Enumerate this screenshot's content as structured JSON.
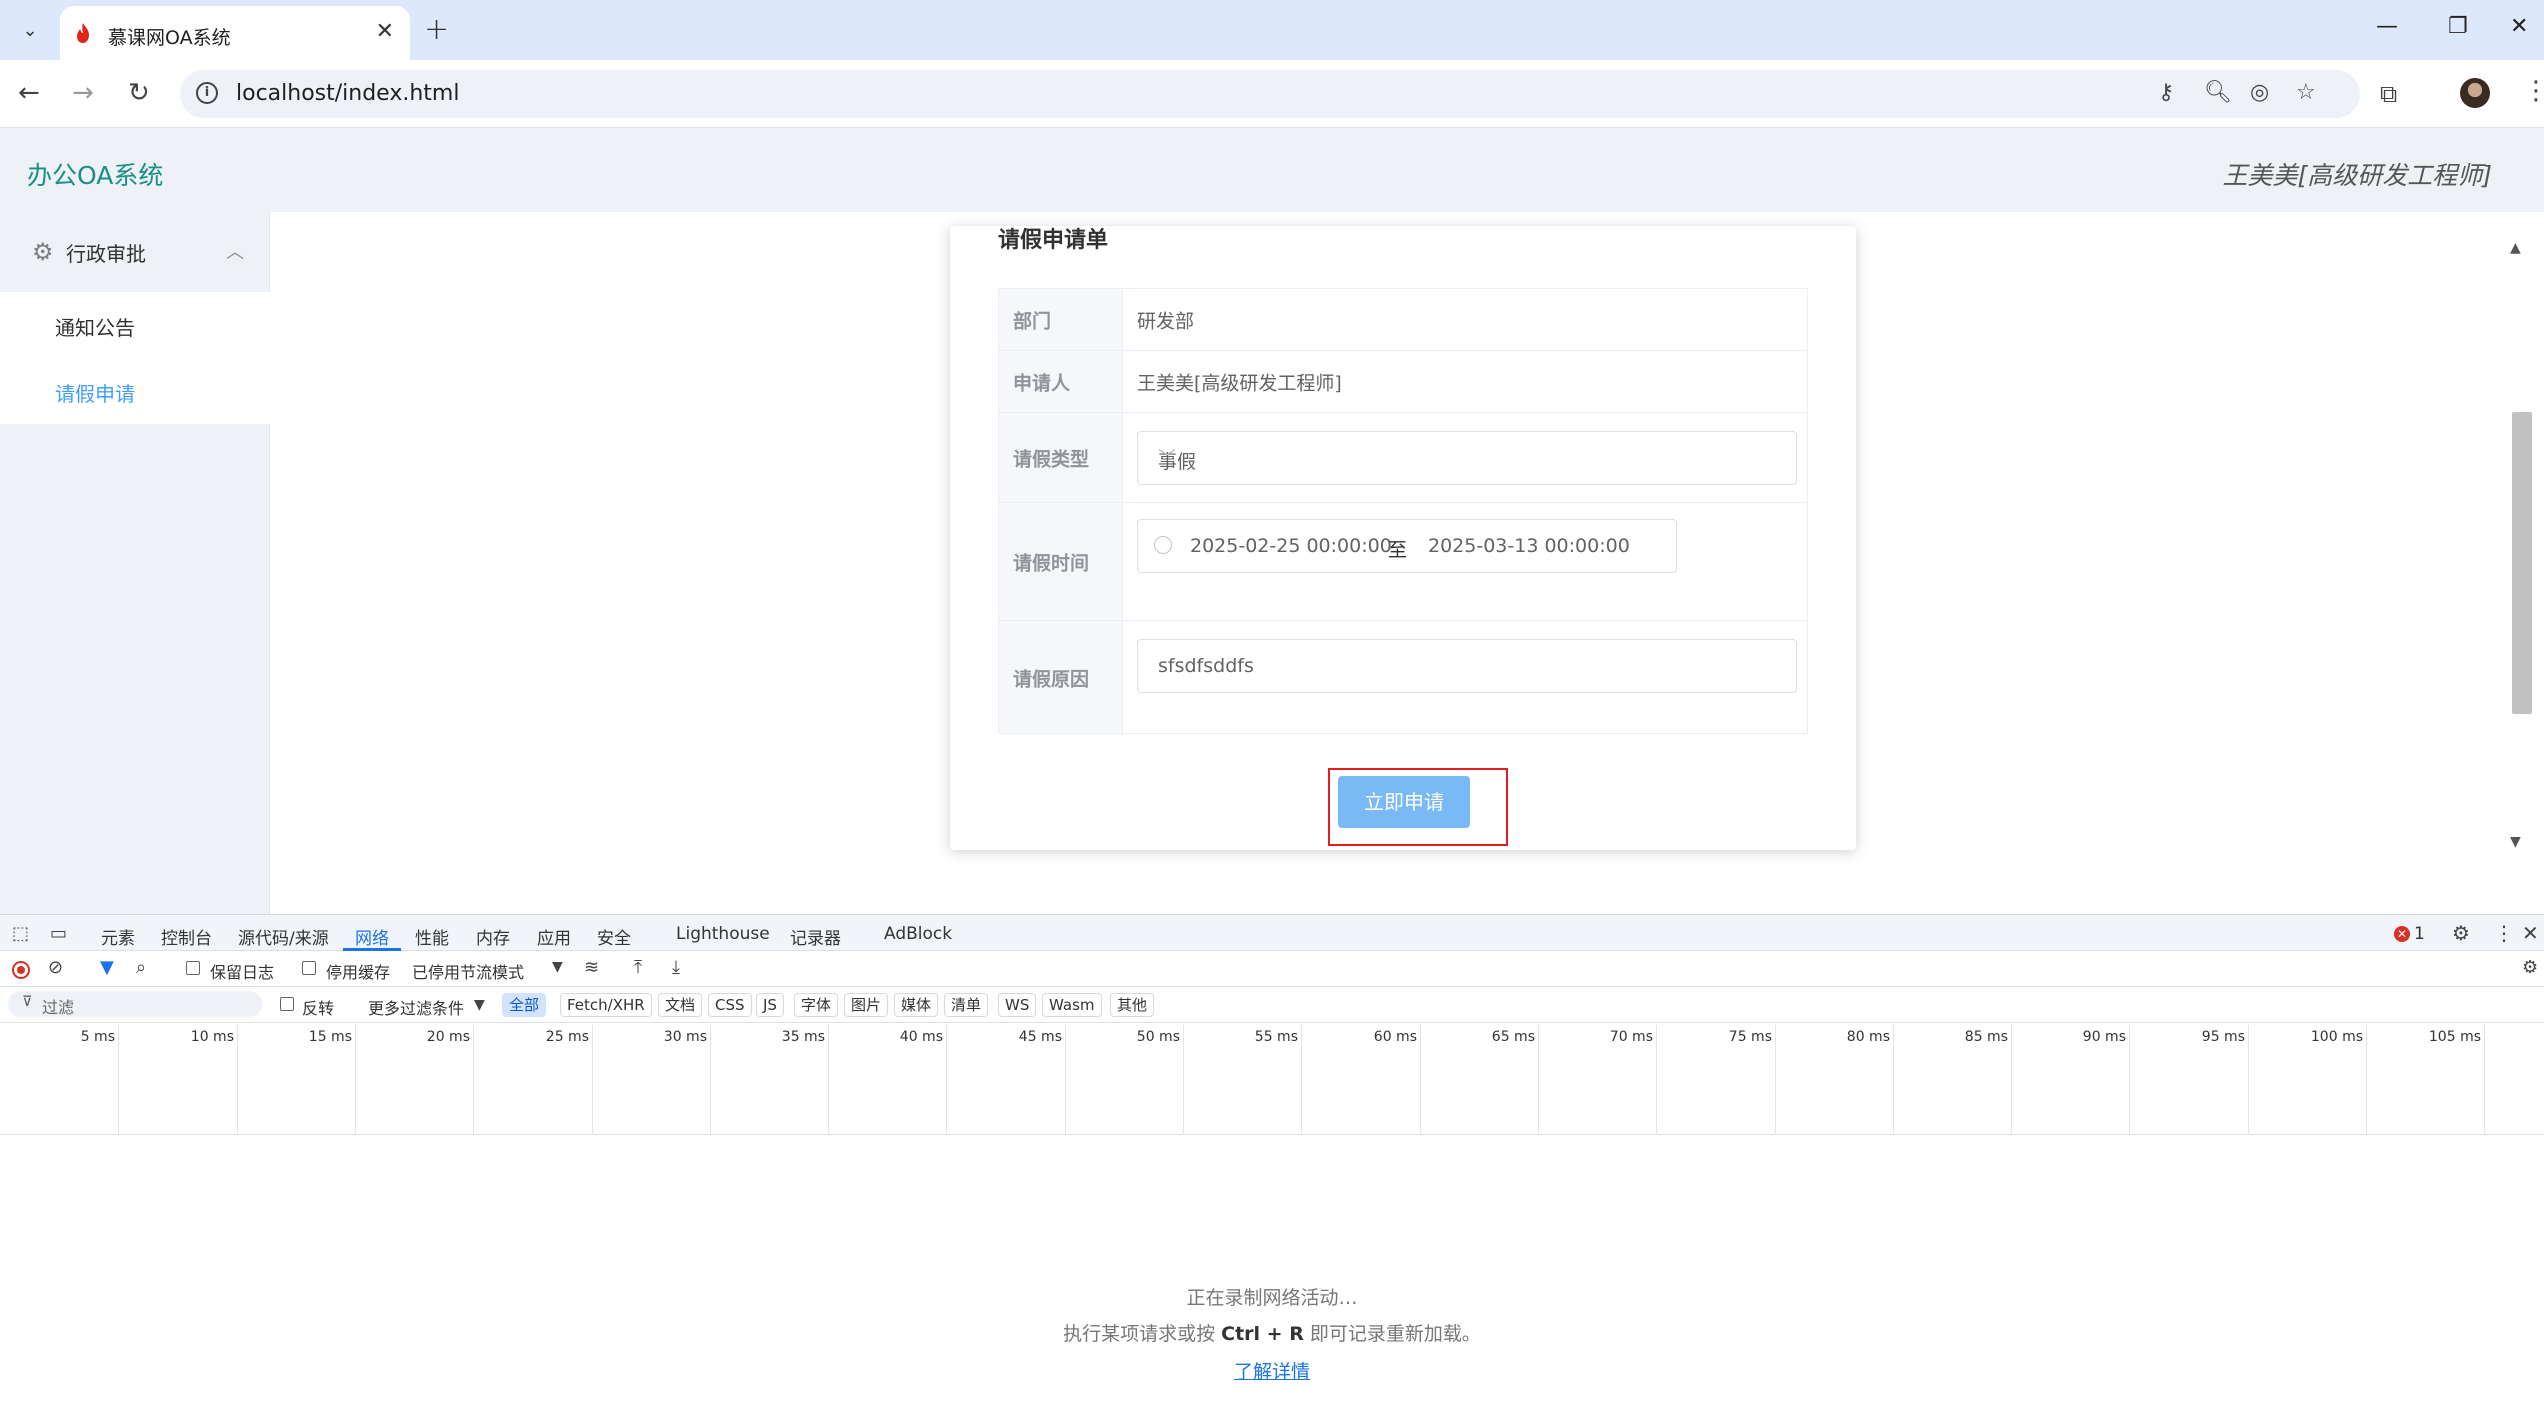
{
  "browser": {
    "tab_title": "慕课网OA系统",
    "url": "localhost/index.html"
  },
  "app": {
    "logo": "办公OA系统",
    "user": "王美美[高级研发工程师]"
  },
  "sidebar": {
    "group_title": "行政审批",
    "items": [
      {
        "label": "通知公告",
        "active": false
      },
      {
        "label": "请假申请",
        "active": true
      }
    ]
  },
  "form": {
    "title": "请假申请单",
    "rows": [
      {
        "label": "部门",
        "value": "研发部"
      },
      {
        "label": "申请人",
        "value": "王美美[高级研发工程师]"
      },
      {
        "label": "请假类型",
        "value": "事假"
      },
      {
        "label": "请假时间",
        "start": "2025-02-25 00:00:00",
        "separator": "至",
        "end": "2025-03-13 00:00:00"
      },
      {
        "label": "请假原因",
        "value": "sfsdfsddfs"
      }
    ],
    "submit_label": "立即申请"
  },
  "devtools": {
    "tabs": [
      "元素",
      "控制台",
      "源代码/来源",
      "网络",
      "性能",
      "内存",
      "应用",
      "安全",
      "Lighthouse",
      "记录器",
      "AdBlock"
    ],
    "active_tab": "网络",
    "error_count": "1",
    "toolbar": {
      "preserve_log": "保留日志",
      "disable_cache": "停用缓存",
      "throttle": "已停用节流模式"
    },
    "filter": {
      "placeholder": "过滤",
      "invert": "反转",
      "more_filters": "更多过滤条件",
      "chips": [
        "全部",
        "Fetch/XHR",
        "文档",
        "CSS",
        "JS",
        "字体",
        "图片",
        "媒体",
        "清单",
        "WS",
        "Wasm",
        "其他"
      ]
    },
    "timeline_ticks": [
      "5 ms",
      "10 ms",
      "15 ms",
      "20 ms",
      "25 ms",
      "30 ms",
      "35 ms",
      "40 ms",
      "45 ms",
      "50 ms",
      "55 ms",
      "60 ms",
      "65 ms",
      "70 ms",
      "75 ms",
      "80 ms",
      "85 ms",
      "90 ms",
      "95 ms",
      "100 ms",
      "105 ms"
    ],
    "empty_state": {
      "line1": "正在录制网络活动…",
      "line2_prefix": "执行某项请求或按",
      "line2_key": "Ctrl + R",
      "line2_suffix": "即可记录重新加载。",
      "learn_more": "了解详情"
    }
  },
  "colors": {
    "brand": "#1a8f85",
    "active_menu": "#409eff",
    "submit": "#79b9f5",
    "highlight_border": "#e02020"
  }
}
